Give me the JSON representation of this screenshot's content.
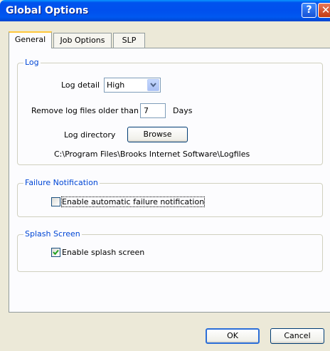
{
  "window": {
    "title": "Global Options",
    "help_symbol": "?",
    "close_symbol": "✕"
  },
  "tabs": [
    {
      "label": "General",
      "active": true
    },
    {
      "label": "Job Options",
      "active": false
    },
    {
      "label": "SLP",
      "active": false
    }
  ],
  "log": {
    "legend": "Log",
    "detail_label": "Log detail",
    "detail_value": "High",
    "remove_label": "Remove log files older than",
    "remove_value": "7",
    "remove_unit": "Days",
    "directory_label": "Log directory",
    "browse_label": "Browse",
    "directory_path": "C:\\Program Files\\Brooks Internet Software\\Logfiles"
  },
  "failure": {
    "legend": "Failure Notification",
    "checkbox_label": "Enable automatic failure notification",
    "checked": false
  },
  "splash": {
    "legend": "Splash Screen",
    "checkbox_label": "Enable splash screen",
    "checked": true
  },
  "buttons": {
    "ok_label": "OK",
    "cancel_label": "Cancel"
  },
  "colors": {
    "titlebar": "#0053ee",
    "legend_text": "#0046d5",
    "dialog_bg": "#ece9d8"
  }
}
